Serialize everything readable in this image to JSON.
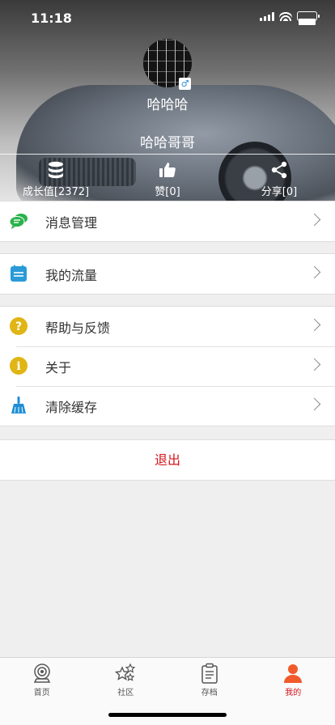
{
  "status_bar": {
    "time": "11:18"
  },
  "profile": {
    "username": "哈哈哈",
    "nickname": "哈哈哥哥",
    "gender_symbol": "♂"
  },
  "stats": {
    "growth": "成长值[2372]",
    "likes": "赞[0]",
    "share": "分享[0]"
  },
  "menu": {
    "messages": "消息管理",
    "traffic": "我的流量",
    "help": "帮助与反馈",
    "about": "关于",
    "clear_cache": "清除缓存",
    "logout": "退出"
  },
  "tabbar": {
    "items": [
      {
        "label": "首页",
        "icon": "camera-icon",
        "active": false
      },
      {
        "label": "社区",
        "icon": "stars-icon",
        "active": false
      },
      {
        "label": "存档",
        "icon": "clipboard-icon",
        "active": false
      },
      {
        "label": "我的",
        "icon": "person-icon",
        "active": true
      }
    ]
  },
  "colors": {
    "accent_red": "#d4141b",
    "message_green": "#2bb24c",
    "traffic_blue": "#2a9bd7",
    "help_yellow": "#e0b514",
    "cache_blue": "#1f8fd6"
  }
}
